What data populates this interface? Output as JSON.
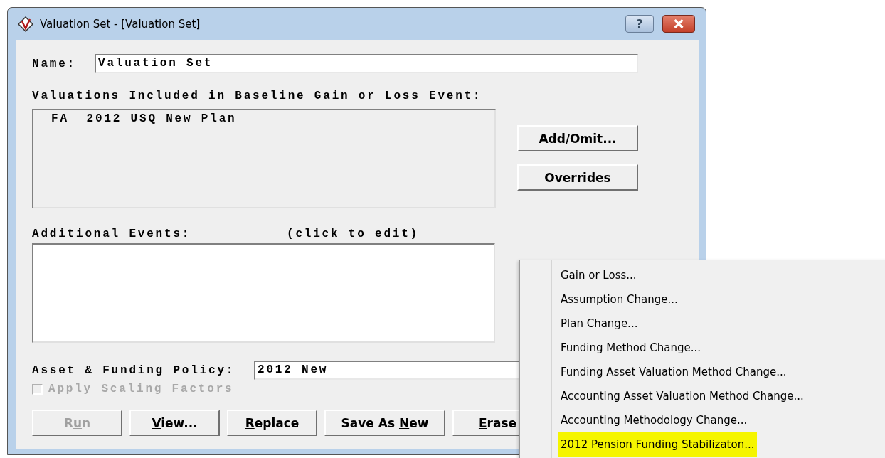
{
  "window": {
    "title": "Valuation Set - [Valuation Set]",
    "help_button": "?"
  },
  "name": {
    "label": "Name:",
    "value": "Valuation Set"
  },
  "valuations": {
    "label": "Valuations Included in Baseline Gain or Loss Event:",
    "items": [
      {
        "code": "FA",
        "name": "2012 USQ New Plan"
      }
    ]
  },
  "side_buttons": [
    {
      "key": "A",
      "after": "dd/Omit...",
      "disabled": false
    },
    {
      "before": "Overr",
      "key": "i",
      "after": "des",
      "disabled": false
    }
  ],
  "additional_events": {
    "label": "Additional Events:",
    "hint": "(click to edit)"
  },
  "policy": {
    "label": "Asset & Funding Policy:",
    "value": "2012 New"
  },
  "scaling": {
    "label": "Apply Scaling Factors",
    "checked": false,
    "disabled": true
  },
  "buttons": [
    {
      "before": "R",
      "key": "u",
      "after": "n",
      "disabled": true
    },
    {
      "key": "V",
      "after": "iew...",
      "disabled": false
    },
    {
      "key": "R",
      "after": "eplace",
      "disabled": false
    },
    {
      "before": "Save As ",
      "key": "N",
      "after": "ew",
      "disabled": false
    },
    {
      "key": "E",
      "after": "rase",
      "disabled": false
    }
  ],
  "menu": [
    {
      "label": "Gain or Loss...",
      "highlighted": false
    },
    {
      "label": "Assumption Change...",
      "highlighted": false
    },
    {
      "label": "Plan Change...",
      "highlighted": false
    },
    {
      "label": "Funding Method Change...",
      "highlighted": false
    },
    {
      "label": "Funding Asset Valuation Method Change...",
      "highlighted": false
    },
    {
      "label": "Accounting Asset Valuation Method Change...",
      "highlighted": false
    },
    {
      "label": "Accounting Methodology Change...",
      "highlighted": false
    },
    {
      "label": "2012 Pension Funding Stabilizaton...",
      "highlighted": true
    }
  ]
}
